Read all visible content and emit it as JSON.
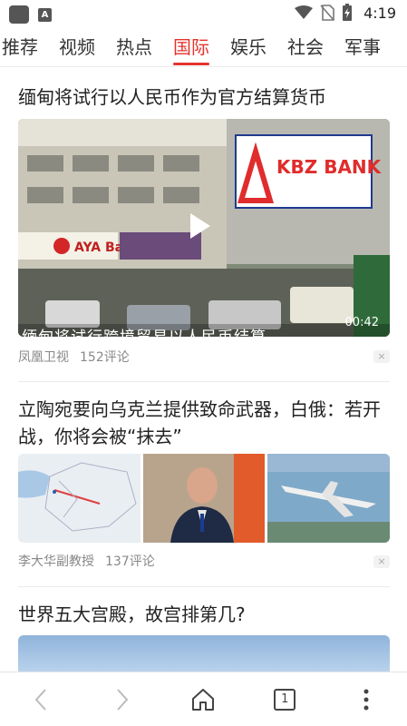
{
  "status_bar": {
    "time": "4:19"
  },
  "tabs": [
    {
      "label": "推荐"
    },
    {
      "label": "视频"
    },
    {
      "label": "热点"
    },
    {
      "label": "国际",
      "active": true
    },
    {
      "label": "娱乐"
    },
    {
      "label": "社会"
    },
    {
      "label": "军事"
    }
  ],
  "accent_color": "#e5322d",
  "articles": [
    {
      "title": "缅甸将试行以人民币作为官方结算货币",
      "video_duration": "00:42",
      "video_caption": "缅甸将试行跨境贸易以人民币结算",
      "signs": {
        "left": "AYA Bank",
        "right": "KBZ BANK"
      },
      "source": "凤凰卫视",
      "comments": "152评论",
      "close": "×"
    },
    {
      "title": "立陶宛要向乌克兰提供致命武器，白俄：若开战，你将会被“抹去”",
      "source": "李大华副教授",
      "comments": "137评论",
      "close": "×"
    },
    {
      "title": "世界五大宫殿，故宫排第几?"
    }
  ],
  "bottom_nav": {
    "tab_count": "1"
  }
}
